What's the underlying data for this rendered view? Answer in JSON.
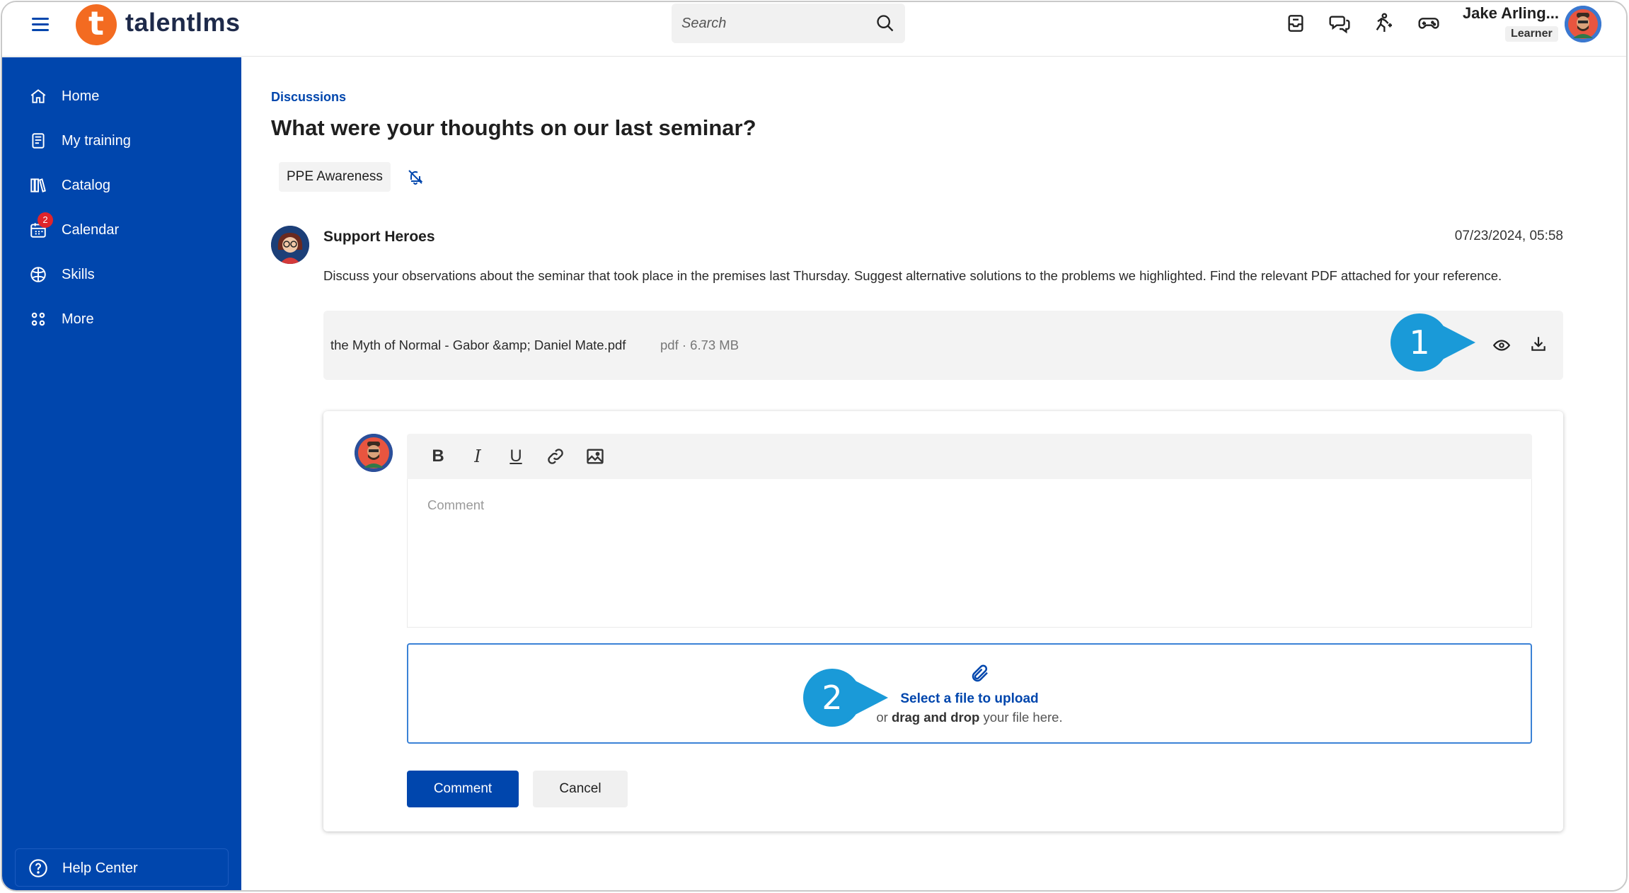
{
  "topbar": {
    "logo_text": "talentlms",
    "search_placeholder": "Search",
    "user_name": "Jake Arling...",
    "user_role": "Learner"
  },
  "sidebar": {
    "items": [
      {
        "label": "Home",
        "icon": "home-icon"
      },
      {
        "label": "My training",
        "icon": "book-icon"
      },
      {
        "label": "Catalog",
        "icon": "library-icon"
      },
      {
        "label": "Calendar",
        "icon": "calendar-icon",
        "badge": "2"
      },
      {
        "label": "Skills",
        "icon": "skills-icon"
      },
      {
        "label": "More",
        "icon": "grid-icon"
      }
    ],
    "help_label": "Help Center"
  },
  "main": {
    "breadcrumb": "Discussions",
    "title": "What were your thoughts on our last seminar?",
    "tag": "PPE Awareness",
    "post": {
      "author": "Support Heroes",
      "timestamp": "07/23/2024, 05:58",
      "body": "Discuss your observations about the seminar that took place in the premises last Thursday. Suggest alternative solutions to the problems we highlighted. Find the relevant PDF attached for your reference."
    },
    "attachment": {
      "name": "the Myth of Normal - Gabor &amp; Daniel Mate.pdf",
      "meta": "pdf  · 6.73 MB"
    },
    "comment_form": {
      "placeholder": "Comment",
      "upload_select": "Select a file to upload",
      "upload_hint_prefix": "or ",
      "upload_hint_bold": "drag and drop",
      "upload_hint_suffix": " your file here.",
      "submit_label": "Comment",
      "cancel_label": "Cancel"
    }
  },
  "callouts": [
    "1",
    "2"
  ],
  "colors": {
    "brand_blue": "#0046ad",
    "logo_orange": "#f36b21",
    "callout_blue": "#1a9ad8",
    "badge_red": "#e0242b"
  }
}
